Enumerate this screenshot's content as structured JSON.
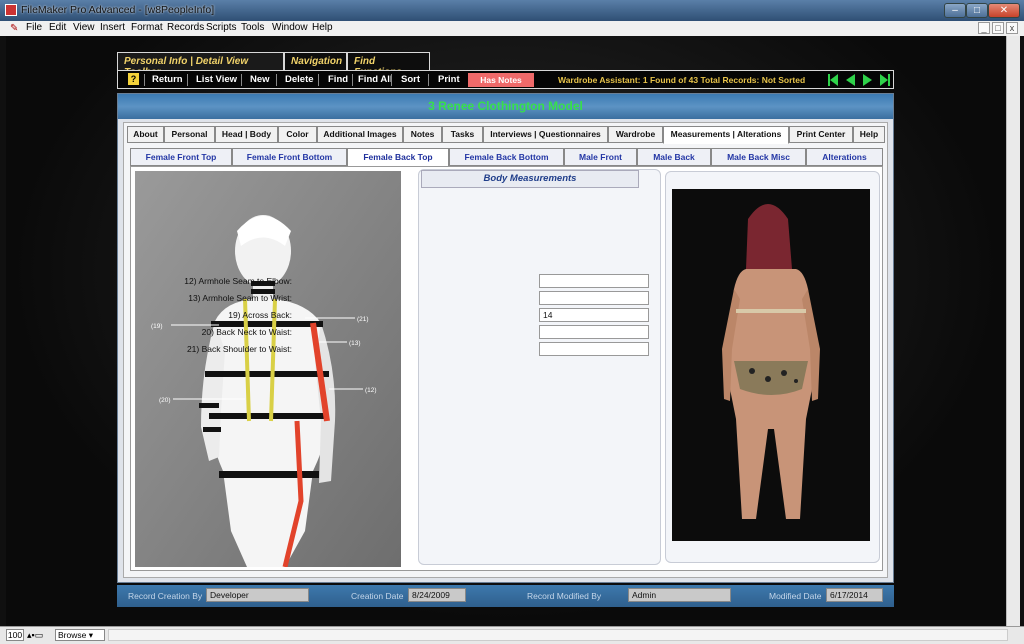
{
  "window": {
    "title": "FileMaker Pro Advanced - [w8PeopleInfo]",
    "controls": {
      "minimize": "–",
      "maximize": "□",
      "close": "✕"
    }
  },
  "menu": {
    "items": [
      "File",
      "Edit",
      "View",
      "Insert",
      "Format",
      "Records",
      "Scripts",
      "Tools",
      "Window",
      "Help"
    ],
    "mdi_controls": [
      "_",
      "□",
      "x"
    ]
  },
  "toolbar_tabs": {
    "personal": "Personal Info | Detail View Toolbar",
    "navigation": "Navigation",
    "find": "Find Functions"
  },
  "toolbar": {
    "help_icon": "?",
    "buttons": [
      "Return",
      "List View",
      "New",
      "Delete",
      "Find",
      "Find All",
      "Sort",
      "Print"
    ],
    "has_notes": "Has Notes",
    "assistant": "Wardrobe Assistant:  1 Found of 43 Total Records: Not Sorted"
  },
  "header": {
    "record": "3   Renee Clothington   Model"
  },
  "tabs_main": [
    "About",
    "Personal",
    "Head | Body",
    "Color",
    "Additional Images",
    "Notes",
    "Tasks",
    "Interviews | Questionnaires",
    "Wardrobe",
    "Measurements | Alterations",
    "Print Center",
    "Help"
  ],
  "tabs_sub": [
    "Female Front Top",
    "Female Front Bottom",
    "Female Back Top",
    "Female Back Bottom",
    "Male Front",
    "Male Back",
    "Male Back Misc",
    "Alterations"
  ],
  "measurements": {
    "title": "Body Measurements",
    "rows": [
      {
        "label": "12)  Armhole Seam to Elbow:",
        "value": ""
      },
      {
        "label": "13)  Armhole Seam to Wrist:",
        "value": ""
      },
      {
        "label": "19)  Across Back:",
        "value": "14"
      },
      {
        "label": "20)  Back Neck to Waist:",
        "value": ""
      },
      {
        "label": "21)  Back Shoulder to Waist:",
        "value": ""
      }
    ]
  },
  "mannequin_labels": [
    "(19)",
    "(21)",
    "(13)",
    "(12)",
    "(20)"
  ],
  "footer": {
    "created_by_label": "Record Creation By",
    "created_by": "Developer",
    "creation_date_label": "Creation Date",
    "creation_date": "8/24/2009",
    "modified_by_label": "Record Modified By",
    "modified_by": "Admin",
    "modified_date_label": "Modified Date",
    "modified_date": "6/17/2014"
  },
  "status": {
    "zoom": "100",
    "mode": "Browse"
  }
}
